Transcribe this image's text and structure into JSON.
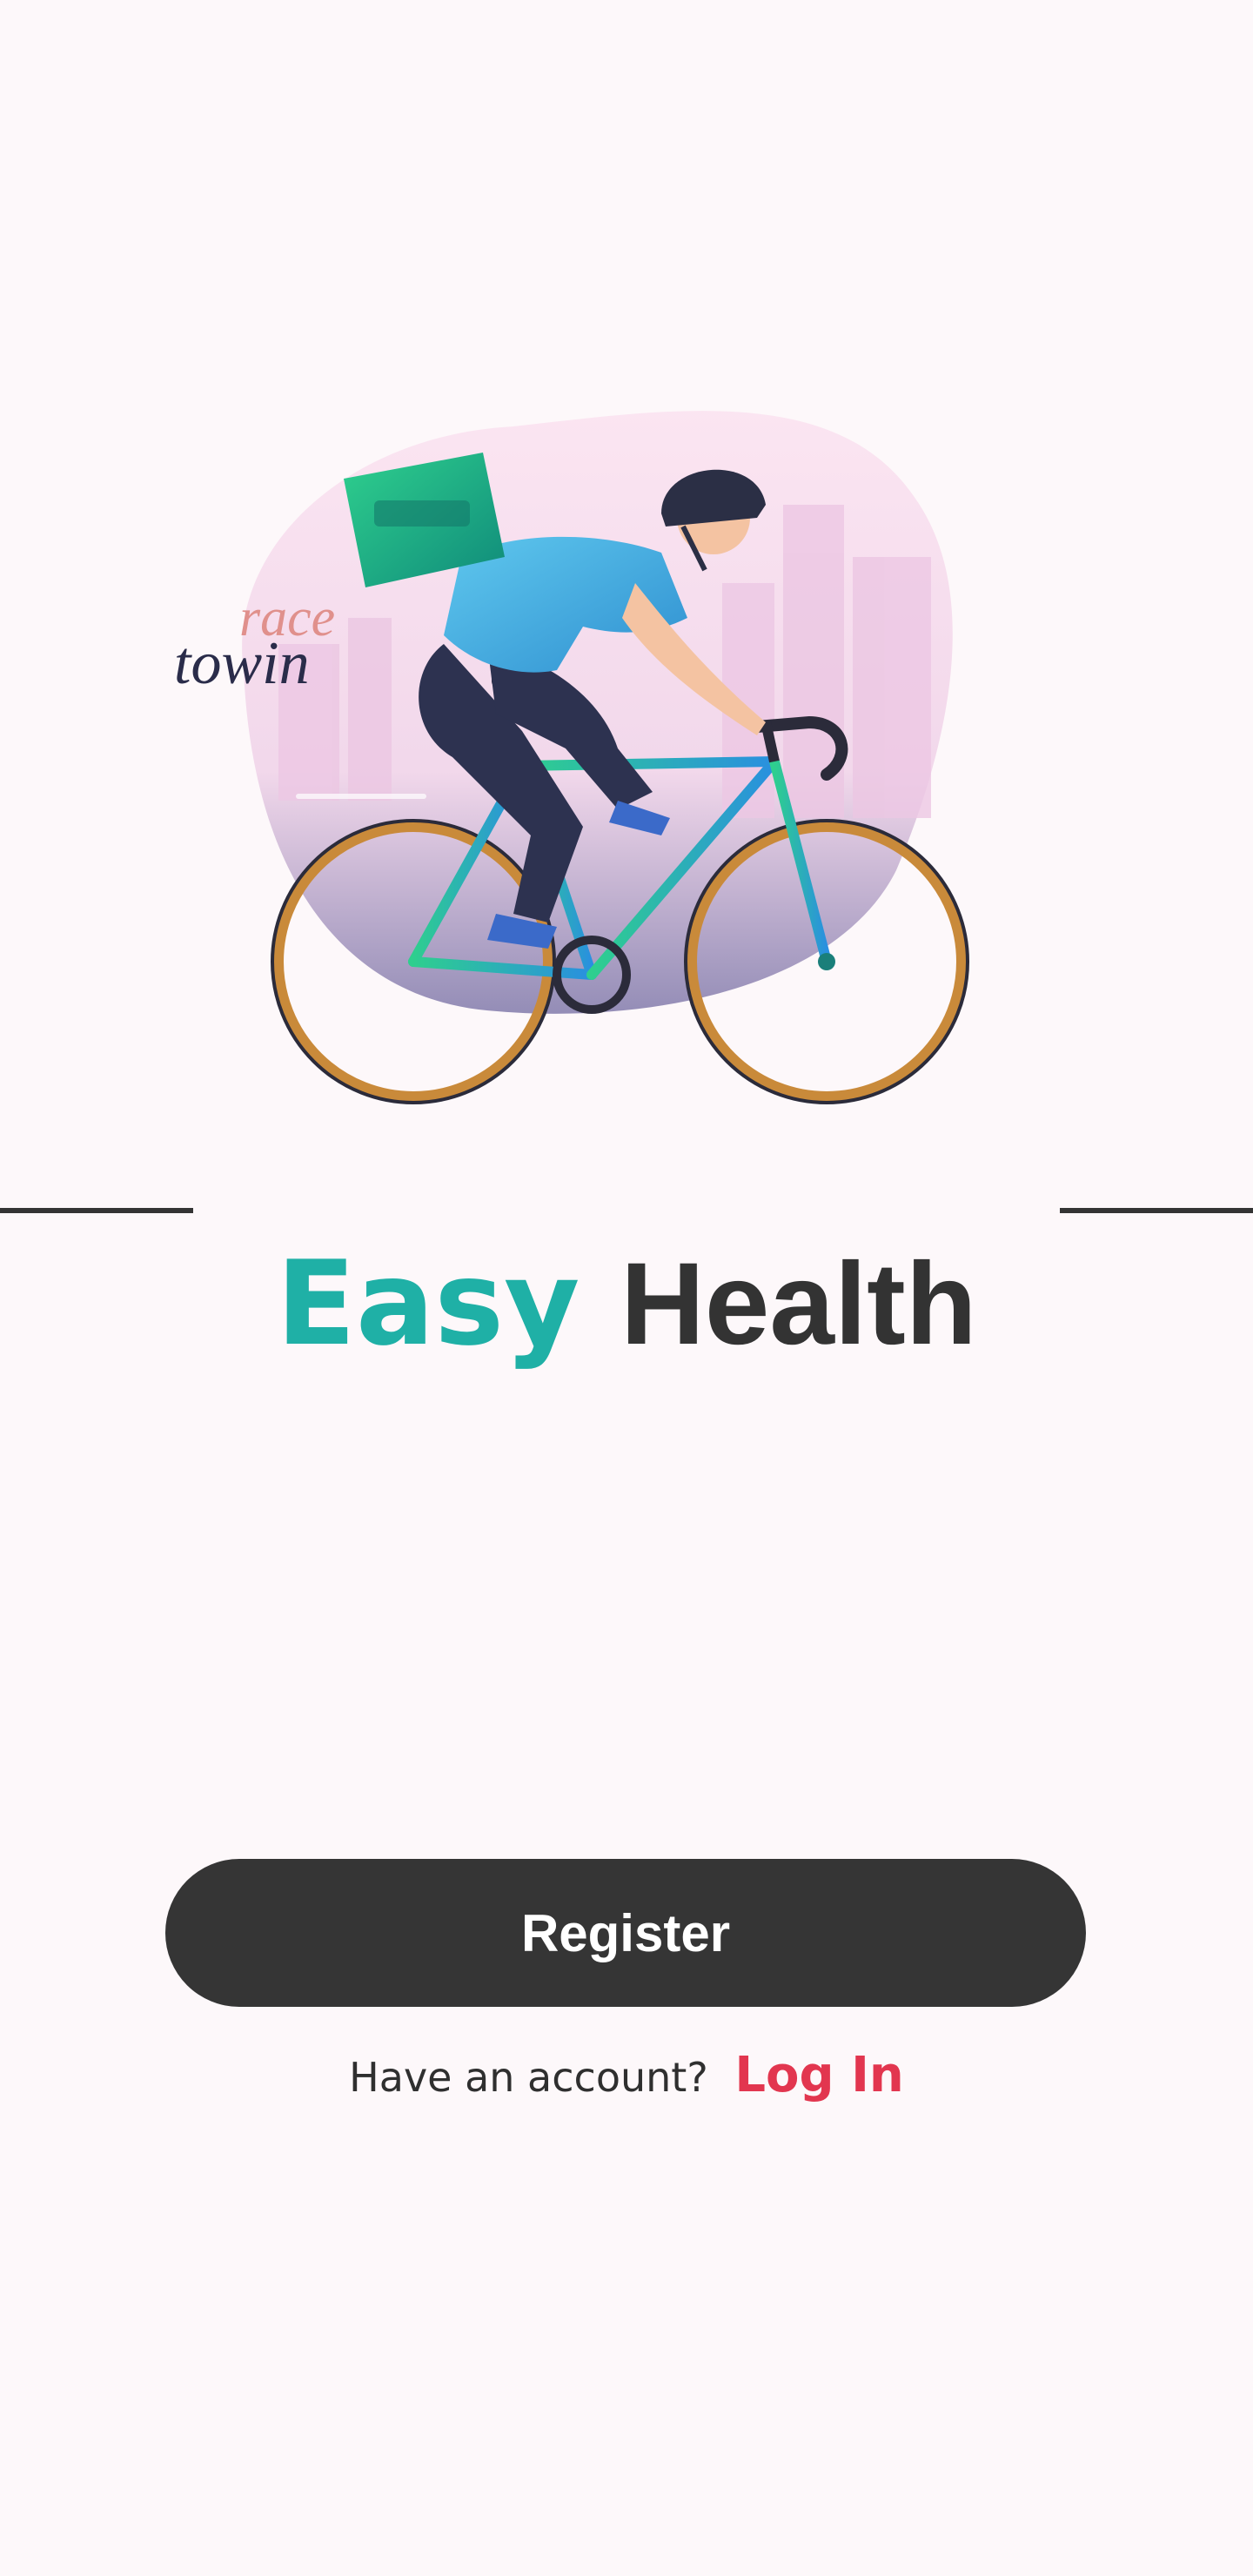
{
  "illustration": {
    "logo_text_top": "race",
    "logo_text_bottom": "towin"
  },
  "title": {
    "part1": "Easy",
    "part2": "Health"
  },
  "actions": {
    "register_label": "Register",
    "account_prompt": "Have an account?",
    "login_label": "Log In"
  },
  "colors": {
    "accent_teal": "#1fb0a6",
    "button_dark": "#353535",
    "login_red": "#e2364f",
    "background": "#fdf8fa"
  }
}
